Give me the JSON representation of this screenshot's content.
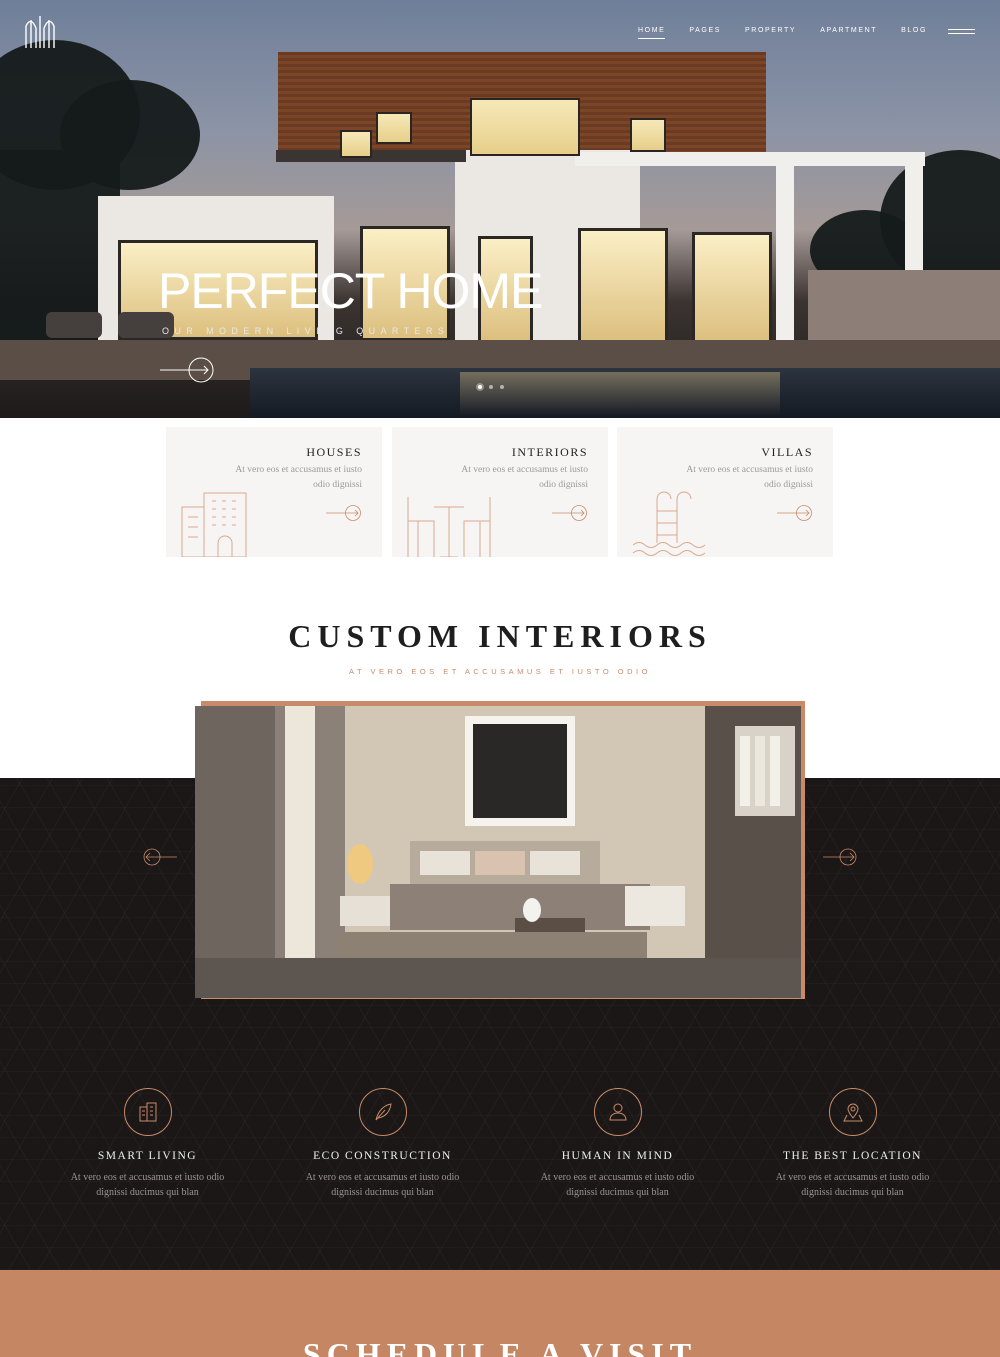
{
  "nav": {
    "items": [
      {
        "label": "HOME",
        "active": true
      },
      {
        "label": "PAGES",
        "active": false
      },
      {
        "label": "PROPERTY",
        "active": false
      },
      {
        "label": "APARTMENT",
        "active": false
      },
      {
        "label": "BLOG",
        "active": false
      }
    ],
    "menu_icon": "hamburger-icon",
    "logo_icon": "building-logo-icon"
  },
  "hero": {
    "title": "PERFECT HOME",
    "subtitle": "OUR MODERN LIVING QUARTERS",
    "arrow_icon": "arrow-right-circle-icon",
    "slides": 3,
    "active_slide": 1
  },
  "cards": [
    {
      "title": "HOUSES",
      "text": "At vero eos et accusamus et iusto odio dignissi",
      "icon": "building-icon"
    },
    {
      "title": "INTERIORS",
      "text": "At vero eos et accusamus et iusto odio dignissi",
      "icon": "table-chairs-icon"
    },
    {
      "title": "VILLAS",
      "text": "At vero eos et accusamus et iusto odio dignissi",
      "icon": "pool-ladder-icon"
    }
  ],
  "interiors": {
    "title": "CUSTOM INTERIORS",
    "subtitle": "AT VERO EOS ET ACCUSAMUS ET IUSTO ODIO"
  },
  "features": [
    {
      "title": "SMART LIVING",
      "text": "At vero eos et accusamus et iusto odio dignissi ducimus qui blan",
      "icon": "smart-building-icon"
    },
    {
      "title": "ECO CONSTRUCTION",
      "text": "At vero eos et accusamus et iusto odio dignissi ducimus qui blan",
      "icon": "leaf-icon"
    },
    {
      "title": "HUMAN IN MIND",
      "text": "At vero eos et accusamus et iusto odio dignissi ducimus qui blan",
      "icon": "person-icon"
    },
    {
      "title": "THE BEST LOCATION",
      "text": "At vero eos et accusamus et iusto odio dignissi ducimus qui blan",
      "icon": "map-pin-icon"
    }
  ],
  "schedule": {
    "title": "SCHEDULE A VISIT"
  },
  "colors": {
    "accent": "#c98a6a",
    "dark_bg": "#1a1716",
    "card_bg": "#f6f5f3",
    "schedule_bg": "#c58664"
  }
}
